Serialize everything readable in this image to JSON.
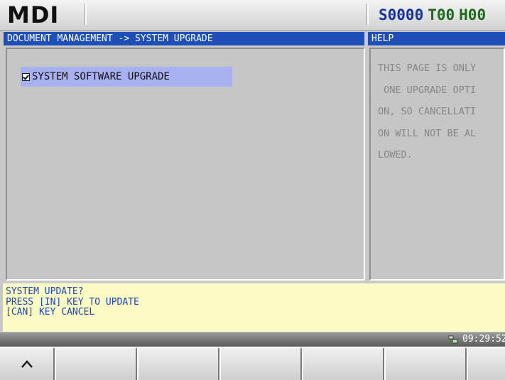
{
  "header": {
    "mode": "MDI",
    "spindle": "S0000",
    "tool": "T00",
    "h_offset": "H00",
    "colors": {
      "spindle": "#1530a0",
      "tool": "#1c6a1c",
      "h_offset": "#1c6a1c"
    }
  },
  "main_panel": {
    "title": "DOCUMENT MANAGEMENT -> SYSTEM UPGRADE",
    "options": [
      {
        "label": "SYSTEM SOFTWARE UPGRADE",
        "checked": true,
        "selected": true
      }
    ]
  },
  "help_panel": {
    "title": "HELP",
    "lines": [
      "THIS PAGE IS ONLY",
      " ONE UPGRADE OPTI",
      "ON, SO CANCELLATI",
      "ON WILL NOT BE AL",
      "LOWED."
    ]
  },
  "message": {
    "lines": [
      "SYSTEM UPDATE?",
      "PRESS [IN] KEY TO UPDATE",
      "[CAN] KEY CANCEL"
    ]
  },
  "status_bar": {
    "time": "09:29:52",
    "icon": "network-icon"
  },
  "softkeys": {
    "first_icon": "chevron-up-icon",
    "labels": [
      "",
      "",
      "",
      "",
      "",
      ""
    ]
  },
  "theme": {
    "title_bg": "#1e4fb8",
    "message_bg": "#fbfbc3",
    "message_text": "#1846c0",
    "selection_bg": "#a8b0f0"
  }
}
